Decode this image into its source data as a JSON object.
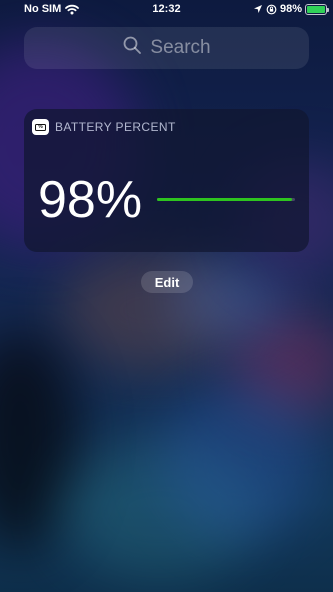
{
  "status_bar": {
    "carrier": "No SIM",
    "time": "12:32",
    "battery_percent": "98%",
    "battery_level": 0.98,
    "icons": [
      "wifi-icon",
      "location-icon",
      "lock-rotation-icon",
      "battery-charging-icon"
    ]
  },
  "search": {
    "placeholder": "Search",
    "icon": "search-icon"
  },
  "widget": {
    "title": "BATTERY PERCENT",
    "app_icon": "battery-app-icon",
    "value": "98%",
    "level": 0.98,
    "bar_color": "#2ec41f"
  },
  "edit_label": "Edit"
}
